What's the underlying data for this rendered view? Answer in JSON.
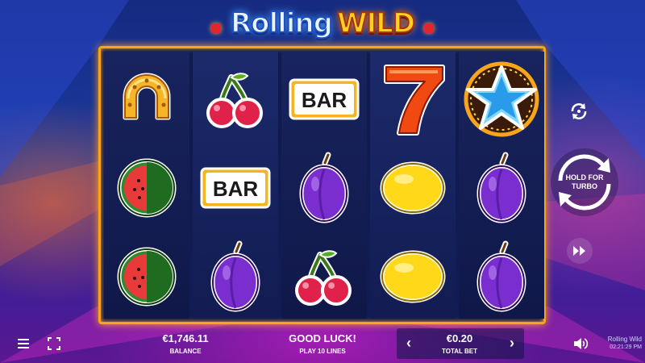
{
  "game": {
    "logo_part1": "Rolling",
    "logo_part2": "WILD"
  },
  "reels": [
    [
      "horseshoe-icon",
      "watermelon-icon",
      "watermelon-icon"
    ],
    [
      "cherries-icon",
      "bar-icon",
      "plum-icon"
    ],
    [
      "bar-icon",
      "plum-icon",
      "cherries-icon"
    ],
    [
      "seven-icon",
      "lemon-icon",
      "lemon-icon"
    ],
    [
      "star-wild-icon",
      "plum-icon",
      "plum-icon"
    ]
  ],
  "bar_label": "BAR",
  "controls": {
    "spin_label_line1": "HOLD FOR",
    "spin_label_line2": "TURBO",
    "autoplay_icon": "autoplay-icon",
    "turbo_icon": "fast-forward-icon"
  },
  "bottom_bar": {
    "balance_value": "€1,746.11",
    "balance_label": "BALANCE",
    "message": "GOOD LUCK!",
    "lines_label": "PLAY 10 LINES",
    "bet_value": "€0.20",
    "bet_label": "TOTAL BET",
    "decrease_glyph": "‹",
    "increase_glyph": "›",
    "game_name": "Rolling Wild",
    "clock": "02:21:29 PM"
  },
  "colors": {
    "frame": "#f6a51c",
    "logo_wild": "#ffd21f",
    "logo_rolling": "#e9f4ff"
  }
}
